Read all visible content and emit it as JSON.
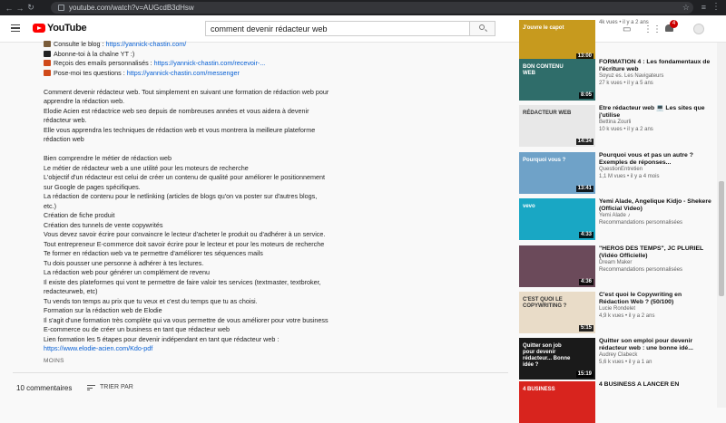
{
  "browser": {
    "url": "youtube.com/watch?v=AUGcdB3dHsw"
  },
  "header": {
    "logo_text": "YouTube",
    "search_value": "comment devenir rédacteur web",
    "notification_count": "4"
  },
  "description": {
    "links": [
      {
        "prefix": "Consulte le blog : ",
        "link": "https://yannick-chastin.com/",
        "icon_color": "#7a5c3a"
      },
      {
        "prefix": "Abonne-toi à la chaîne YT :)",
        "link": "",
        "icon_color": "#222222"
      },
      {
        "prefix": "Reçois des emails personnalisés : ",
        "link": "https://yannick-chastin.com/recevoir-...",
        "icon_color": "#d04a1a"
      },
      {
        "prefix": "Pose-moi tes questions : ",
        "link": "https://yannick-chastin.com/messenger",
        "icon_color": "#d04a1a"
      }
    ],
    "para1": [
      "Comment devenir rédacteur web. Tout simplement en suivant une formation de rédaction web pour",
      "apprendre la rédaction web.",
      "Elodie Acien est rédactrice web seo depuis de nombreuses années et vous aidera à devenir",
      "rédacteur web.",
      "Elle vous apprendra les techniques de rédaction web et vous montrera la meilleure plateforme",
      "rédaction web"
    ],
    "para2": [
      "Bien comprendre le métier de rédaction web",
      "Le métier de rédacteur web a une utilité pour les moteurs de recherche",
      "L'objectif d'un rédacteur est celui de créer un contenu de qualité pour améliorer le positionnement",
      "sur Google de pages spécifiques.",
      "La rédaction de contenu pour le netlinking (articles de blogs qu'on va poster sur d'autres blogs,",
      "etc.)",
      "Création de fiche produit",
      "Création des tunnels de vente copywrités",
      "Vous devez savoir écrire pour convaincre le lecteur d'acheter le produit ou d'adhérer à un service.",
      "Tout entrepreneur E-commerce doit savoir écrire pour le lecteur et pour les moteurs de recherche",
      "Te former en rédaction web va te permettre d'améliorer tes séquences mails",
      "Tu dois pousser une personne à adhérer à tes lectures.",
      "La rédaction web pour générer un complément de revenu",
      "Il existe des plateformes qui vont te permettre de faire valoir tes services (textmaster, textbroker,",
      "redacteurweb, etc)",
      "Tu vends ton temps au prix que tu veux et c'est du temps que tu as choisi.",
      "Formation sur la rédaction web de Elodie",
      "Il s'agit d'une formation très complète qui va vous permettre de vous améliorer pour votre business",
      "E-commerce ou de créer un business en tant que rédacteur web",
      "Lien formation les 5 étapes pour devenir indépendant en tant que rédacteur web :"
    ],
    "final_link": "https://www.elodie-acien.com/Kdo-pdf",
    "less_label": "MOINS"
  },
  "comments": {
    "count_label": "10 commentaires",
    "sort_label": "TRIER PAR"
  },
  "sidebar": {
    "videos": [
      {
        "title": "",
        "channel": "",
        "stats": "4k vues • il y a 2 ans",
        "duration": "13:00",
        "thumb_color": "#c79a1e",
        "thumb_text": "J'ouvre le capot"
      },
      {
        "title": "FORMATION 4 : Les fondamentaux de l'écriture web",
        "channel": "Soyuz es. Les Navigateurs",
        "stats": "27 k vues • il y a 5 ans",
        "duration": "8:05",
        "thumb_color": "#2f6d6a",
        "thumb_text": "BON CONTENU WEB"
      },
      {
        "title": "Etre rédacteur web 💻 Les sites que j'utilise",
        "channel": "Bettina Zourli",
        "stats": "10 k vues • il y a 2 ans",
        "duration": "14:34",
        "thumb_color": "#e8e8e8",
        "thumb_text": "RÉDACTEUR WEB"
      },
      {
        "title": "Pourquoi vous et pas un autre ? Exemples de réponses...",
        "channel": "QuestionEntretien",
        "stats": "1,1 M vues • il y a 4 mois",
        "duration": "13:41",
        "thumb_color": "#6fa2c8",
        "thumb_text": "Pourquoi vous ?"
      },
      {
        "title": "Yemi Alade, Angelique Kidjo - Shekere (Official Video)",
        "channel": "Yemi Alade ♪",
        "stats": "Recommandations personnalisées",
        "duration": "4:33",
        "thumb_color": "#19a7c4",
        "thumb_text": "vevo"
      },
      {
        "title": "\"HEROS DES TEMPS\", JC PLURIEL (Vidéo Officielle)",
        "channel": "Dream Maker",
        "stats": "Recommandations personnalisées",
        "duration": "4:36",
        "thumb_color": "#6b4a5a",
        "thumb_text": ""
      },
      {
        "title": "C'est quoi le Copywriting en Rédaction Web ? (50/100)",
        "channel": "Lucie Rondelet",
        "stats": "4,9 k vues • il y a 2 ans",
        "duration": "5:15",
        "thumb_color": "#e9dcc8",
        "thumb_text": "C'EST QUOI LE COPYWRITING ?"
      },
      {
        "title": "Quitter son emploi pour devenir rédacteur web : une bonne idé...",
        "channel": "Audrey Clabeck",
        "stats": "5,6 k vues • il y a 1 an",
        "duration": "15:19",
        "thumb_color": "#1a1a1a",
        "thumb_text": "Quitter son job pour devenir rédacteur... Bonne idée ?"
      },
      {
        "title": "4 BUSINESS A LANCER EN",
        "channel": "",
        "stats": "",
        "duration": "",
        "thumb_color": "#d8241e",
        "thumb_text": "4 BUSINESS"
      }
    ]
  }
}
